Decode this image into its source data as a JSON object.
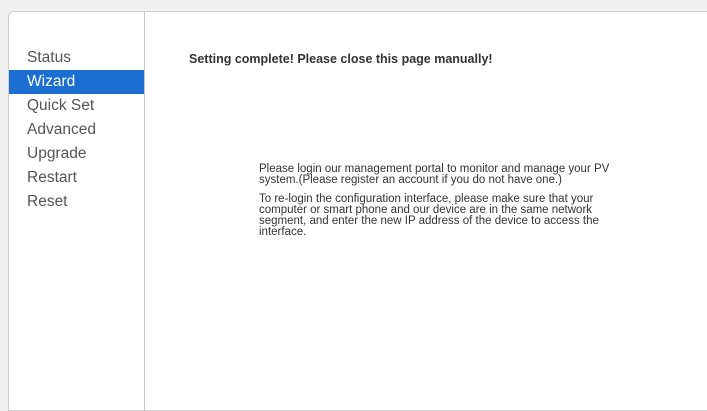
{
  "sidebar": {
    "items": [
      {
        "label": "Status"
      },
      {
        "label": "Wizard"
      },
      {
        "label": "Quick Set"
      },
      {
        "label": "Advanced"
      },
      {
        "label": "Upgrade"
      },
      {
        "label": "Restart"
      },
      {
        "label": "Reset"
      }
    ],
    "active_item": "Wizard"
  },
  "main": {
    "title": "Setting complete! Please close this page manually!",
    "paragraph_1": "Please login our management portal to monitor and manage your PV system.(Please register an account if you do not have one.)",
    "paragraph_2": "To re-login the configuration interface, please make sure that your computer or smart phone and our device are in the same network segment, and enter the new IP address of the device to access the interface."
  },
  "colors": {
    "accent": "#1c6fd1",
    "menu_text": "#555555",
    "body_text": "#333333"
  }
}
